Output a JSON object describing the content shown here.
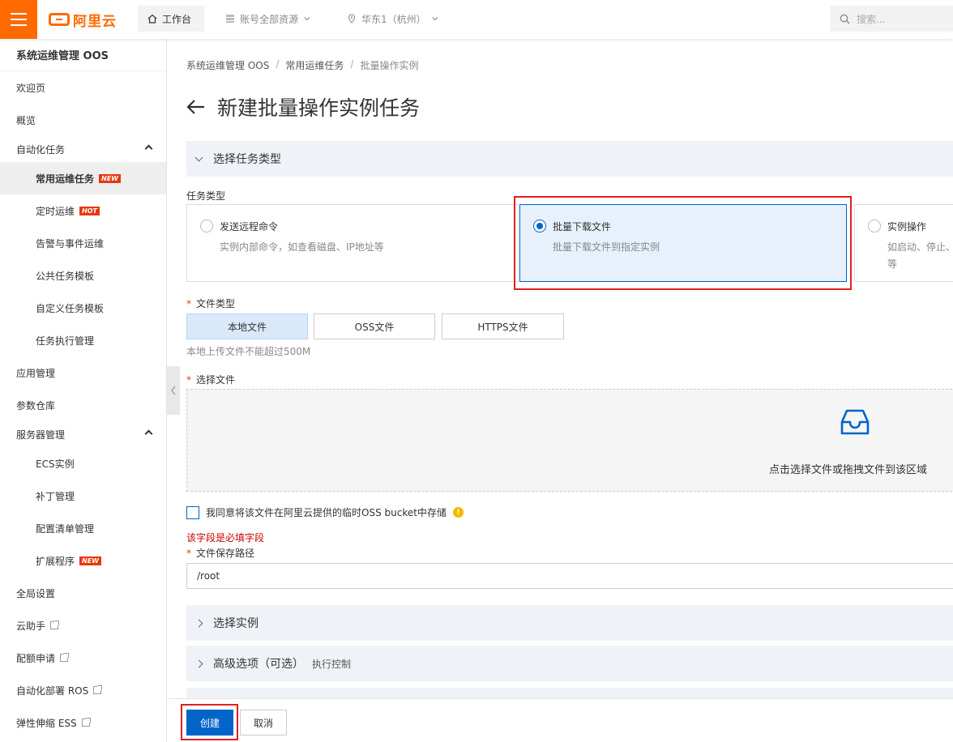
{
  "topbar": {
    "menu_icon": "hamburger-icon",
    "logo_text": "阿里云",
    "workbench": "工作台",
    "resources": "账号全部资源",
    "region": "华东1（杭州）",
    "search_placeholder": "搜索..."
  },
  "sidebar": {
    "title": "系统运维管理 OOS",
    "items": [
      {
        "label": "欢迎页"
      },
      {
        "label": "概览"
      },
      {
        "label": "自动化任务"
      },
      {
        "label": "常用运维任务",
        "badge": "NEW"
      },
      {
        "label": "定时运维",
        "badge": "HOT"
      },
      {
        "label": "告警与事件运维"
      },
      {
        "label": "公共任务模板"
      },
      {
        "label": "自定义任务模板"
      },
      {
        "label": "任务执行管理"
      },
      {
        "label": "应用管理"
      },
      {
        "label": "参数仓库"
      },
      {
        "label": "服务器管理"
      },
      {
        "label": "ECS实例"
      },
      {
        "label": "补丁管理"
      },
      {
        "label": "配置清单管理"
      },
      {
        "label": "扩展程序",
        "badge": "NEW"
      },
      {
        "label": "全局设置"
      },
      {
        "label": "云助手"
      },
      {
        "label": "配额申请"
      },
      {
        "label": "自动化部署 ROS"
      },
      {
        "label": "弹性伸缩 ESS"
      }
    ]
  },
  "breadcrumb": [
    "系统运维管理 OOS",
    "常用运维任务",
    "批量操作实例"
  ],
  "page_title": "新建批量操作实例任务",
  "section_task_type": "选择任务类型",
  "task_type_label": "任务类型",
  "task_types": [
    {
      "title": "发送远程命令",
      "desc": "实例内部命令，如查看磁盘、IP地址等",
      "selected": false
    },
    {
      "title": "批量下载文件",
      "desc": "批量下载文件到指定实例",
      "selected": true
    },
    {
      "title": "实例操作",
      "desc": "如启动、停止、",
      "desc2": "等",
      "selected": false
    }
  ],
  "file_type_label": "文件类型",
  "file_types": [
    "本地文件",
    "OSS文件",
    "HTTPS文件"
  ],
  "file_type_selected": "本地文件",
  "file_type_hint": "本地上传文件不能超过500M",
  "select_file_label": "选择文件",
  "dropzone_text": "点击选择文件或拖拽文件到该区域",
  "agree_text": "我同意将该文件在阿里云提供的临时OSS bucket中存储",
  "error_text": "该字段是必填字段",
  "save_path_label": "文件保存路径",
  "save_path_value": "/root",
  "section_select_instance": "选择实例",
  "section_advanced": "高级选项（可选）",
  "section_advanced_sub": "执行控制",
  "footer": {
    "create": "创建",
    "cancel": "取消"
  },
  "colors": {
    "brand": "#ff6a00",
    "primary": "#0064c8",
    "highlight": "#e02020",
    "error": "#c80000"
  }
}
